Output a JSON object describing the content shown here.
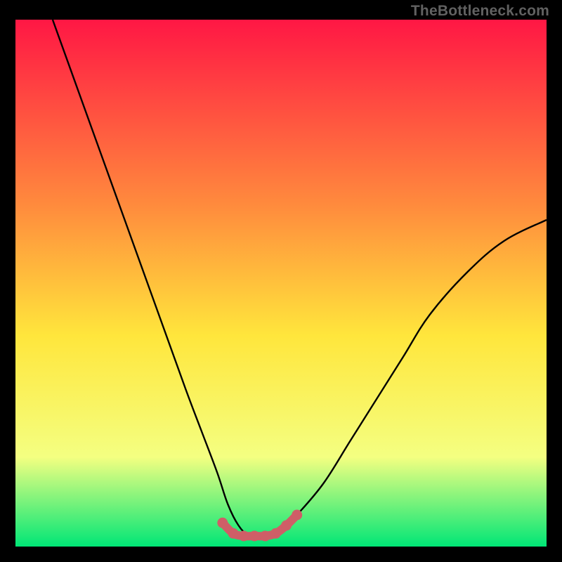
{
  "watermark": "TheBottleneck.com",
  "colors": {
    "background": "#000000",
    "gradient_top": "#ff1744",
    "gradient_upper_mid": "#ff8a3d",
    "gradient_mid": "#ffe63c",
    "gradient_lower_mid": "#f4ff81",
    "gradient_bottom": "#00e676",
    "curve": "#000000",
    "marker": "#cf5e67"
  },
  "chart_data": {
    "type": "line",
    "title": "",
    "xlabel": "",
    "ylabel": "",
    "xlim": [
      0,
      100
    ],
    "ylim": [
      0,
      100
    ],
    "grid": false,
    "legend": false,
    "series": [
      {
        "name": "bottleneck-curve",
        "x": [
          7,
          12,
          17,
          22,
          27,
          32,
          35,
          38,
          40,
          42,
          44,
          46,
          48,
          50,
          53,
          58,
          63,
          68,
          73,
          78,
          85,
          92,
          100
        ],
        "y": [
          100,
          86,
          72,
          58,
          44,
          30,
          22,
          14,
          8,
          4,
          2,
          2,
          2,
          3,
          6,
          12,
          20,
          28,
          36,
          44,
          52,
          58,
          62
        ]
      }
    ],
    "markers": {
      "name": "bottom-markers",
      "x": [
        39,
        41,
        43,
        45,
        47,
        49,
        51,
        53
      ],
      "y": [
        4.5,
        2.5,
        2,
        2,
        2,
        2.5,
        4,
        6
      ]
    }
  }
}
